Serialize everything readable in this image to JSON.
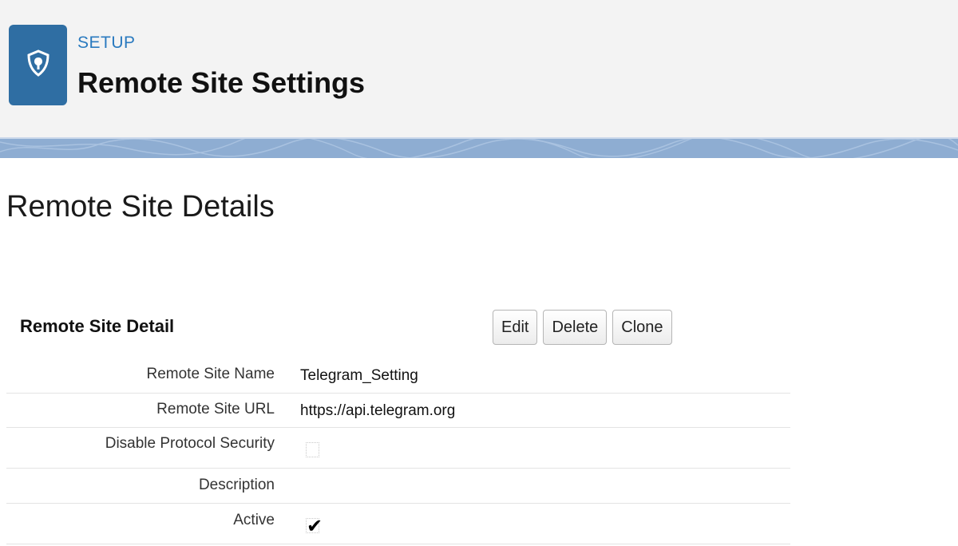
{
  "header": {
    "section_label": "SETUP",
    "title": "Remote Site Settings",
    "icon": "shield-icon",
    "accent_color": "#2f6ea3"
  },
  "page": {
    "heading": "Remote Site Details"
  },
  "detail": {
    "title": "Remote Site Detail",
    "buttons": {
      "edit": "Edit",
      "delete": "Delete",
      "clone": "Clone"
    },
    "fields": {
      "name": {
        "label": "Remote Site Name",
        "value": "Telegram_Setting"
      },
      "url": {
        "label": "Remote Site URL",
        "value": "https://api.telegram.org"
      },
      "disable_protocol_security": {
        "label": "Disable Protocol Security",
        "checked": false
      },
      "description": {
        "label": "Description",
        "value": ""
      },
      "active": {
        "label": "Active",
        "checked": true,
        "check_glyph": "✔"
      }
    }
  }
}
